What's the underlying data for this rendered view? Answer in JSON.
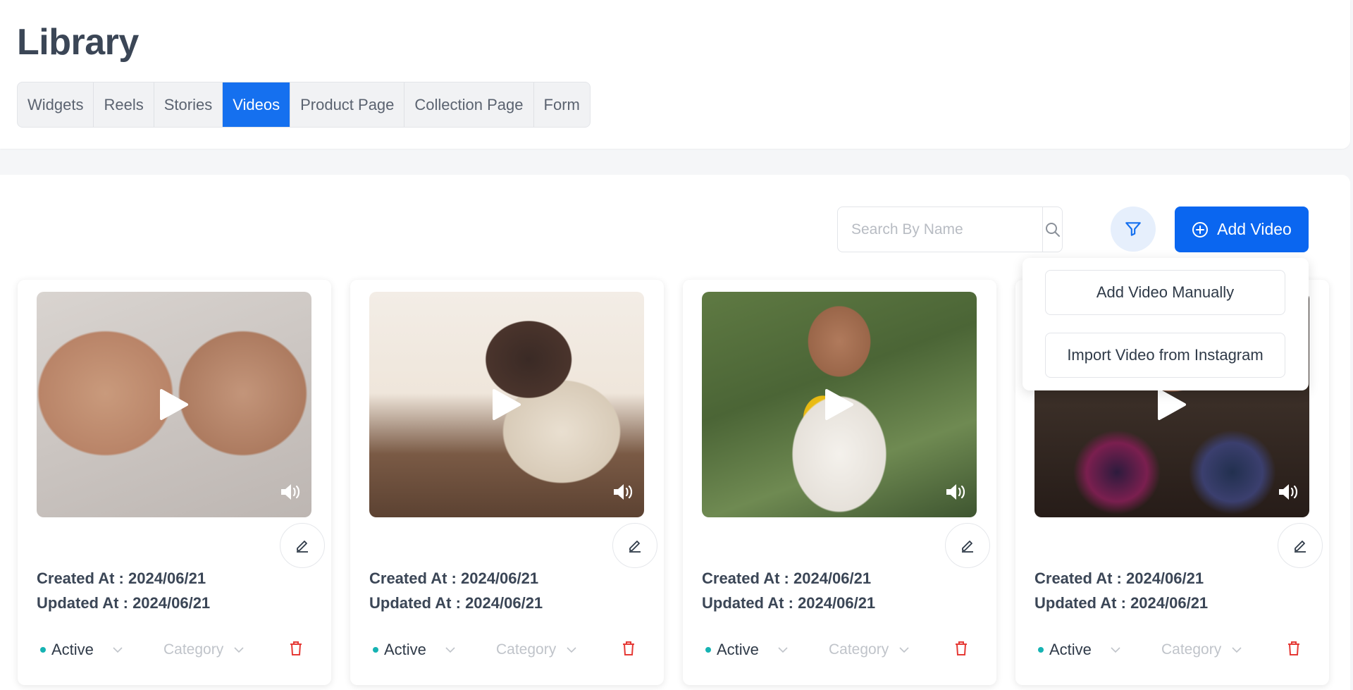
{
  "page": {
    "title": "Library"
  },
  "tabs": [
    {
      "label": "Widgets",
      "active": false
    },
    {
      "label": "Reels",
      "active": false
    },
    {
      "label": "Stories",
      "active": false
    },
    {
      "label": "Videos",
      "active": true
    },
    {
      "label": "Product Page",
      "active": false
    },
    {
      "label": "Collection Page",
      "active": false
    },
    {
      "label": "Form",
      "active": false
    }
  ],
  "toolbar": {
    "search_placeholder": "Search By Name",
    "search_value": "",
    "search_icon": "search-icon",
    "filter_icon": "filter-icon",
    "add_video_label": "Add Video",
    "add_video_icon": "plus-circle-icon"
  },
  "add_menu": {
    "items": [
      "Add Video Manually",
      "Import Video from Instagram"
    ]
  },
  "colors": {
    "accent": "#1570ef",
    "add_button": "#0a66f0",
    "status_active_dot": "#16b3b3",
    "delete_icon": "#e53935"
  },
  "videos": [
    {
      "created_label": "Created At : ",
      "created": "2024/06/21",
      "updated_label": "Updated At : ",
      "updated": "2024/06/21",
      "status": "Active",
      "category": "Category"
    },
    {
      "created_label": "Created At : ",
      "created": "2024/06/21",
      "updated_label": "Updated At : ",
      "updated": "2024/06/21",
      "status": "Active",
      "category": "Category"
    },
    {
      "created_label": "Created At : ",
      "created": "2024/06/21",
      "updated_label": "Updated At : ",
      "updated": "2024/06/21",
      "status": "Active",
      "category": "Category"
    },
    {
      "created_label": "Created At : ",
      "created": "2024/06/21",
      "updated_label": "Updated At : ",
      "updated": "2024/06/21",
      "status": "Active",
      "category": "Category"
    }
  ]
}
